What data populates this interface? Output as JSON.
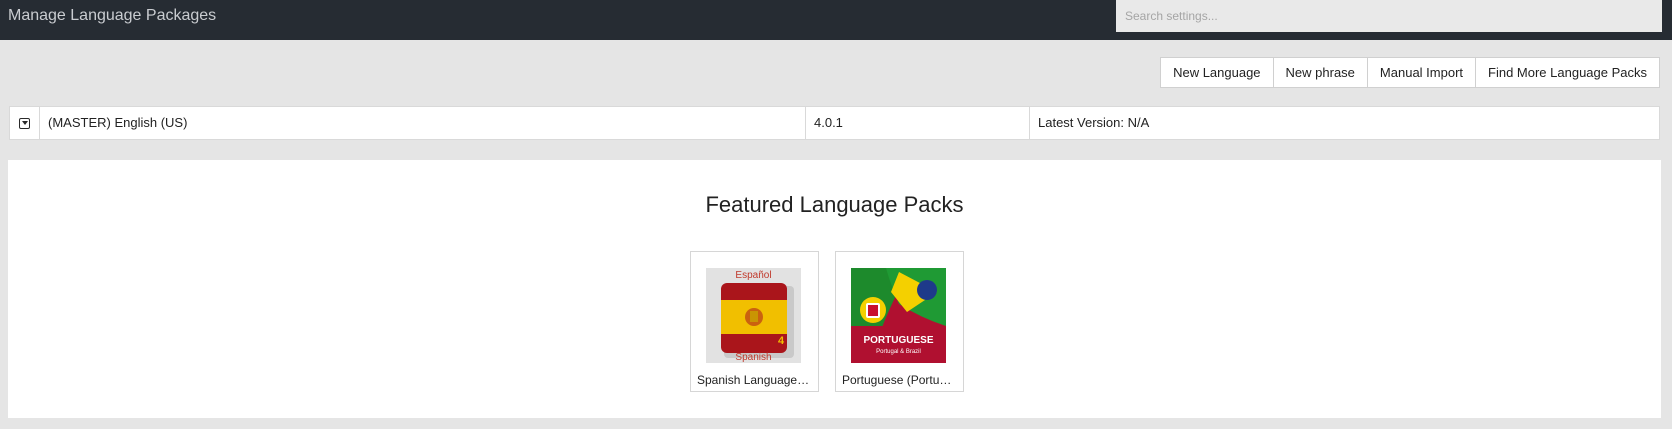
{
  "header": {
    "title": "Manage Language Packages",
    "search_placeholder": "Search settings..."
  },
  "toolbar": {
    "buttons": [
      {
        "label": "New Language"
      },
      {
        "label": "New phrase"
      },
      {
        "label": "Manual Import"
      },
      {
        "label": "Find More Language Packs"
      }
    ]
  },
  "languages": [
    {
      "name": "(MASTER) English (US)",
      "version": "4.0.1",
      "latest": "Latest Version: N/A",
      "toggle_icon": "caret-down-square-icon"
    }
  ],
  "featured": {
    "title": "Featured Language Packs",
    "packs": [
      {
        "name": "Spanish Language Pack",
        "thumb_top_text": "Español",
        "thumb_bottom_text": "Spanish",
        "thumb_badge": "4",
        "colors": {
          "red": "#aa151b",
          "yellow": "#f1bf00",
          "bg": "#e2e2e2"
        }
      },
      {
        "name": "Portuguese (Portugal & Brazil)",
        "thumb_title": "PORTUGUESE",
        "thumb_subtitle": "Portugal & Brazil",
        "colors": {
          "red": "#b01030",
          "green": "#1d8a2c",
          "yellow": "#f4d000"
        }
      }
    ]
  }
}
